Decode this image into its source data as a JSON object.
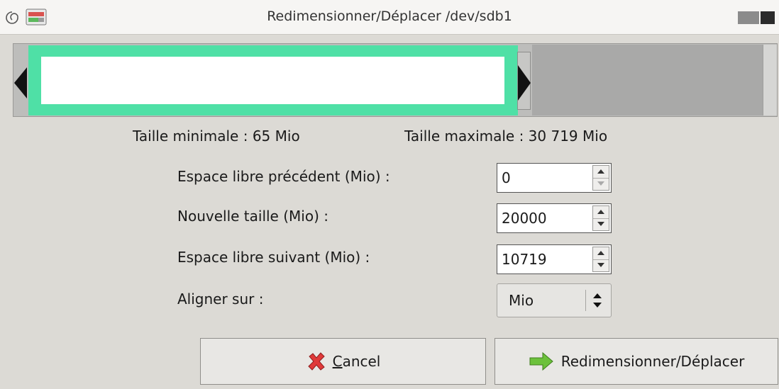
{
  "window": {
    "title": "Redimensionner/Déplacer /dev/sdb1",
    "app_icon": "debian-swirl-icon",
    "window_icon": "gparted-icon"
  },
  "partition_visual": {
    "partition_color": "#4fe0a6",
    "unallocated_color": "#a9a9a8",
    "used_fraction_of_device": 0.651
  },
  "limits": {
    "min_size": "Taille minimale : 65 Mio",
    "max_size": "Taille maximale : 30 719 Mio"
  },
  "fields": {
    "free_before": {
      "label": "Espace libre précédent (Mio) :",
      "value": "0"
    },
    "new_size": {
      "label": "Nouvelle taille (Mio) :",
      "value": "20000"
    },
    "free_after": {
      "label": "Espace libre suivant (Mio) :",
      "value": "10719"
    },
    "align": {
      "label": "Aligner sur :",
      "value": "Mio"
    }
  },
  "buttons": {
    "cancel": {
      "label": "Cancel",
      "icon": "red-cross-icon"
    },
    "resize": {
      "label": "Redimensionner/Déplacer",
      "icon": "green-arrow-icon"
    }
  }
}
